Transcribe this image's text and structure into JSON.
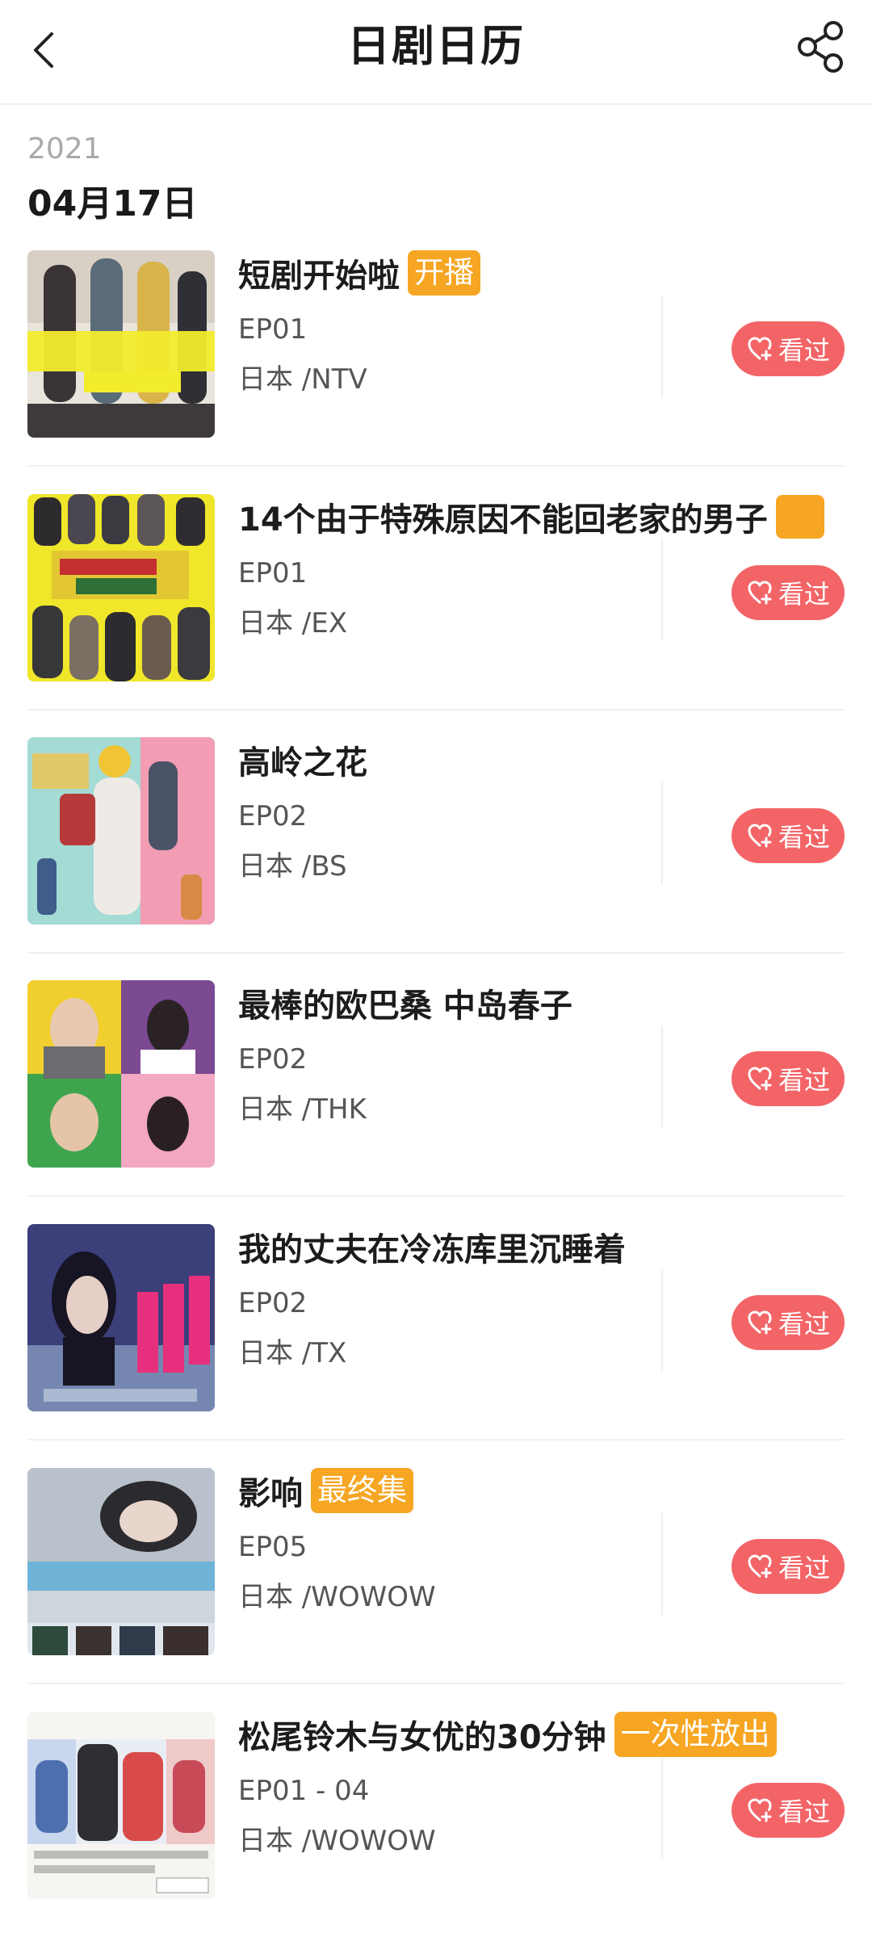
{
  "header": {
    "title": "日剧日历",
    "back_icon": "chevron-left-icon",
    "share_icon": "share-icon"
  },
  "section": {
    "year": "2021",
    "date": "04月17日"
  },
  "colors": {
    "tag": "#f6a623",
    "seen_button": "#f36467",
    "text": "#1c1c1c",
    "sub_text": "#555555"
  },
  "items": [
    {
      "name": "短剧开始啦",
      "tag": "开播",
      "episode": "EP01",
      "network": "日本 /NTV",
      "seen_label": "看过"
    },
    {
      "name": "14个由于特殊原因不能回老家的男子",
      "tag": "",
      "episode": "EP01",
      "network": "日本 /EX",
      "seen_label": "看过"
    },
    {
      "name": "高岭之花",
      "tag": "",
      "episode": "EP02",
      "network": "日本 /BS",
      "seen_label": "看过"
    },
    {
      "name": "最棒的欧巴桑 中岛春子",
      "tag": "",
      "episode": "EP02",
      "network": "日本 /THK",
      "seen_label": "看过"
    },
    {
      "name": "我的丈夫在冷冻库里沉睡着",
      "tag": "",
      "episode": "EP02",
      "network": "日本 /TX",
      "seen_label": "看过"
    },
    {
      "name": "影响",
      "tag": "最终集",
      "episode": "EP05",
      "network": "日本 /WOWOW",
      "seen_label": "看过"
    },
    {
      "name": "松尾铃木与女优的30分钟",
      "tag": "一次性放出",
      "episode": "EP01 - 04",
      "network": "日本 /WOWOW",
      "seen_label": "看过"
    }
  ]
}
